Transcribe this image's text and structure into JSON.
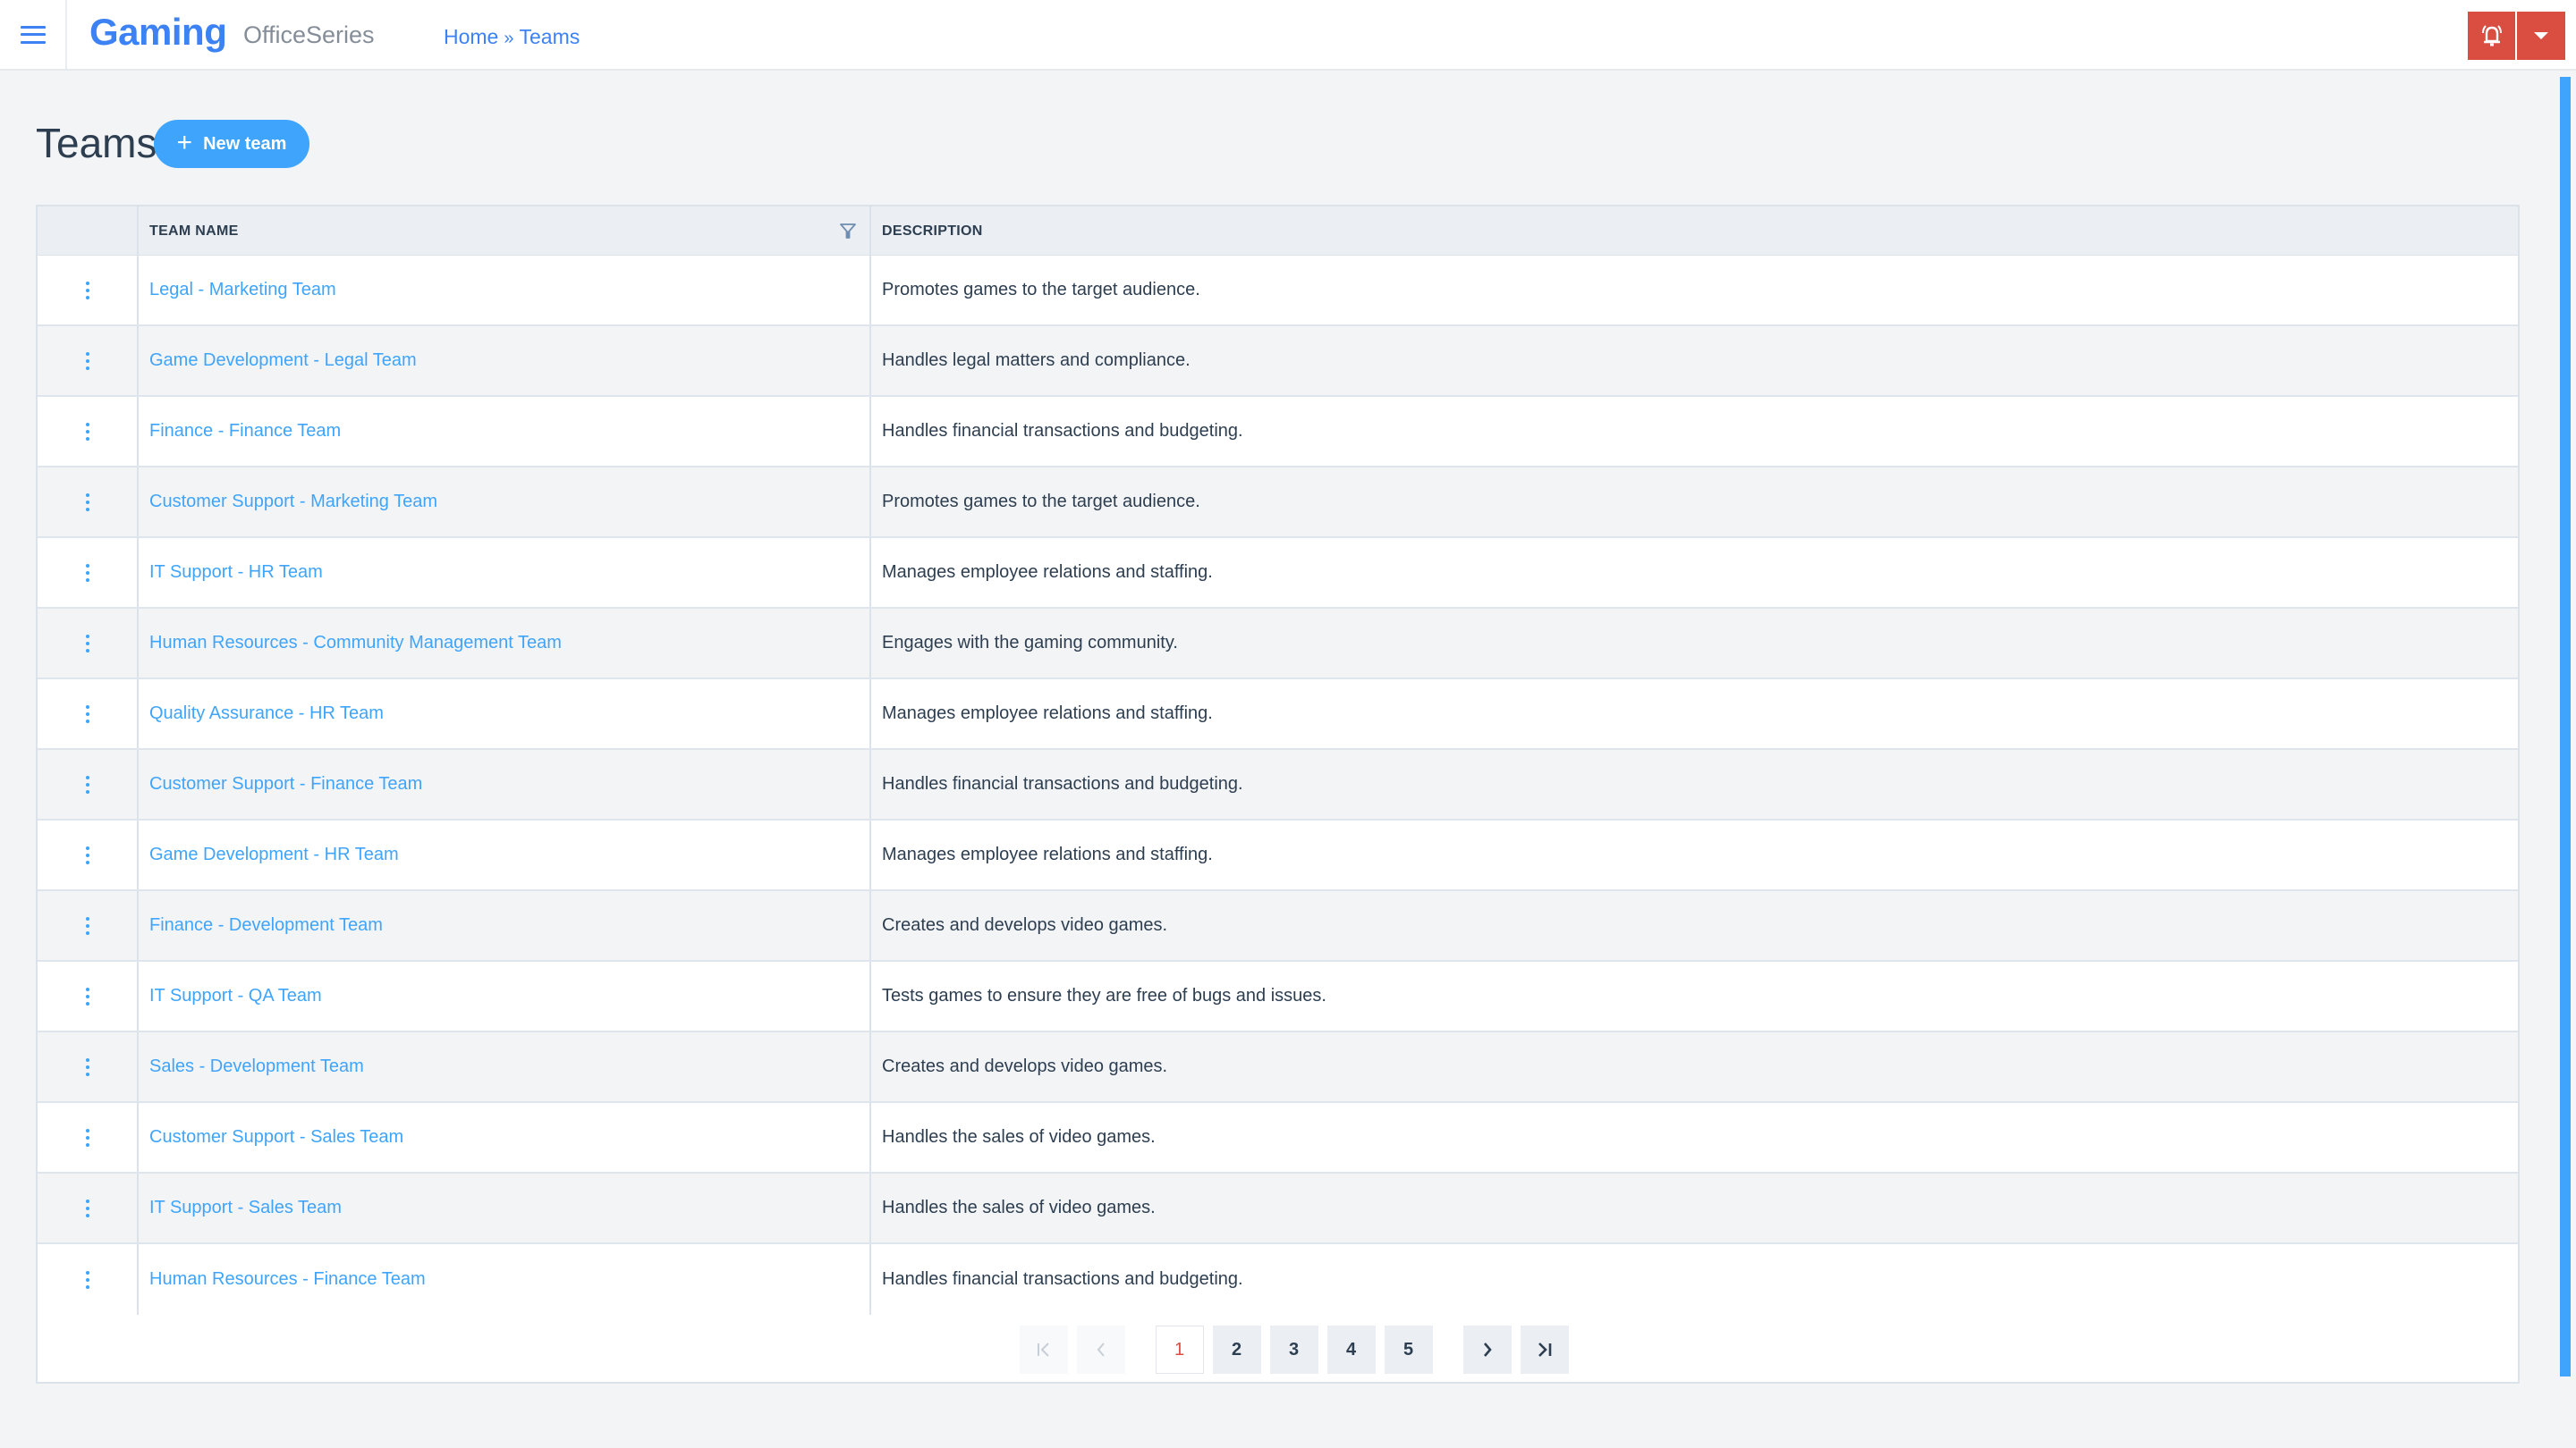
{
  "app": {
    "brand": "Gaming",
    "subbrand": "OfficeSeries",
    "accent_color": "#3d82f5",
    "alert_color": "#d94e41"
  },
  "breadcrumb": {
    "items": [
      {
        "label": "Home"
      },
      {
        "label": "Teams"
      }
    ],
    "separator": "»"
  },
  "header_actions": {
    "alert_icon": "bell-alert-icon",
    "menu_icon": "caret-down-icon"
  },
  "page": {
    "title": "Teams",
    "new_button_label": "New team",
    "new_button_icon": "plus-icon"
  },
  "table": {
    "columns": [
      {
        "key": "actions",
        "label": ""
      },
      {
        "key": "name",
        "label": "TEAM NAME",
        "filter_icon": "filter-icon"
      },
      {
        "key": "description",
        "label": "DESCRIPTION"
      }
    ],
    "rows": [
      {
        "name": "Legal - Marketing Team",
        "description": "Promotes games to the target audience."
      },
      {
        "name": "Game Development - Legal Team",
        "description": "Handles legal matters and compliance."
      },
      {
        "name": "Finance - Finance Team",
        "description": "Handles financial transactions and budgeting."
      },
      {
        "name": "Customer Support - Marketing Team",
        "description": "Promotes games to the target audience."
      },
      {
        "name": "IT Support - HR Team",
        "description": "Manages employee relations and staffing."
      },
      {
        "name": "Human Resources - Community Management Team",
        "description": "Engages with the gaming community."
      },
      {
        "name": "Quality Assurance - HR Team",
        "description": "Manages employee relations and staffing."
      },
      {
        "name": "Customer Support - Finance Team",
        "description": "Handles financial transactions and budgeting."
      },
      {
        "name": "Game Development - HR Team",
        "description": "Manages employee relations and staffing."
      },
      {
        "name": "Finance - Development Team",
        "description": "Creates and develops video games."
      },
      {
        "name": "IT Support - QA Team",
        "description": "Tests games to ensure they are free of bugs and issues."
      },
      {
        "name": "Sales - Development Team",
        "description": "Creates and develops video games."
      },
      {
        "name": "Customer Support - Sales Team",
        "description": "Handles the sales of video games."
      },
      {
        "name": "IT Support - Sales Team",
        "description": "Handles the sales of video games."
      },
      {
        "name": "Human Resources - Finance Team",
        "description": "Handles financial transactions and budgeting."
      }
    ]
  },
  "pagination": {
    "current_page": 1,
    "pages": [
      "1",
      "2",
      "3",
      "4",
      "5"
    ],
    "first_icon": "first-page-icon",
    "prev_icon": "prev-page-icon",
    "next_icon": "next-page-icon",
    "last_icon": "last-page-icon"
  }
}
